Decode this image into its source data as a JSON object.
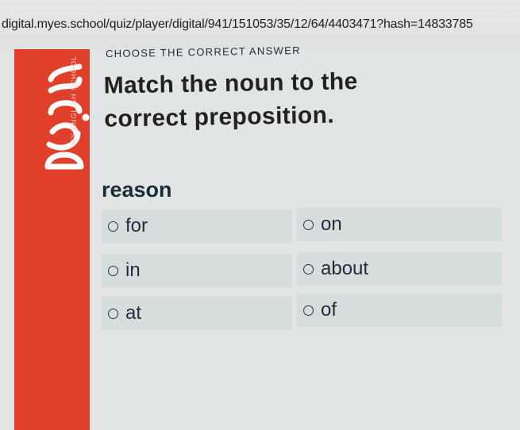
{
  "browser": {
    "url": "digital.myes.school/quiz/player/digital/941/151053/35/12/64/4403471?hash=14833785"
  },
  "brand": {
    "logo_text": "myes",
    "tagline": "MY ENGLISH SCHOOL",
    "accent_color": "#e0402a"
  },
  "quiz": {
    "instruction": "CHOOSE THE CORRECT ANSWER",
    "question": "Match the noun to the correct preposition.",
    "noun": "reason",
    "options": [
      "for",
      "on",
      "in",
      "about",
      "at",
      "of"
    ]
  }
}
